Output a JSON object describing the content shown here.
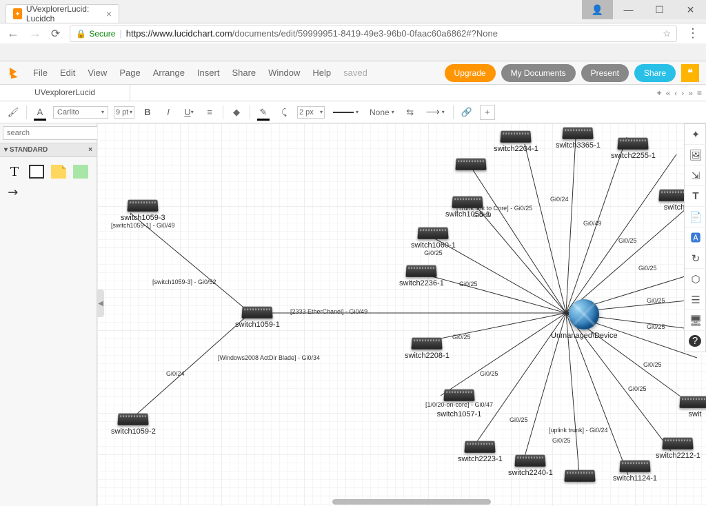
{
  "browser": {
    "tab_title": "UVexplorerLucid: Lucidch",
    "secure_label": "Secure",
    "url_host": "https://www.lucidchart.com",
    "url_path": "/documents/edit/59999951-8419-49e3-96b0-0faac60a6862#?None"
  },
  "menus": {
    "file": "File",
    "edit": "Edit",
    "view": "View",
    "page": "Page",
    "arrange": "Arrange",
    "insert": "Insert",
    "share": "Share",
    "window": "Window",
    "help": "Help",
    "saved": "saved"
  },
  "buttons": {
    "upgrade": "Upgrade",
    "my_documents": "My Documents",
    "present": "Present",
    "share": "Share"
  },
  "doc_tab": "UVexplorerLucid",
  "format": {
    "font": "Carlito",
    "size": "9 pt",
    "line_width": "2 px",
    "line_style": "None"
  },
  "left": {
    "search_placeholder": "search",
    "standard_header": "STANDARD"
  },
  "nodes": {
    "s1059_3": {
      "label": "switch1059-3",
      "sub": "[switch1059-1] - Gi0/49"
    },
    "s1059_1": {
      "label": "switch1059-1"
    },
    "s1059_2": {
      "label": "switch1059-2"
    },
    "center": {
      "label": "Unmanaged\\Device"
    },
    "s1060_1": {
      "label": "switch1060-1"
    },
    "s1058_1": {
      "label": "switch1058-1"
    },
    "s2204_1": {
      "label": "switch2204-1"
    },
    "s3365_1": {
      "label": "switch3365-1"
    },
    "s2255_1": {
      "label": "switch2255-1"
    },
    "s_right": {
      "label": "switch"
    },
    "s2236_1": {
      "label": "switch2236-1"
    },
    "s2208_1": {
      "label": "switch2208-1"
    },
    "s1057_1": {
      "label": "switch1057-1"
    },
    "s2223_1": {
      "label": "switch2223-1"
    },
    "s2240_1": {
      "label": "switch2240-1"
    },
    "s1124_1": {
      "label": "switch1124-1"
    },
    "s2212_1": {
      "label": "switch2212-1"
    },
    "s_br": {
      "label": "swit"
    }
  },
  "edges": {
    "e1": "[switch1059-3] - Gi0/52",
    "e2": "[2333 EtherChanel] - Gi0/49",
    "e3": "[Windows2008 ActDir Blade] - Gi0/34",
    "e4": "Gi0/24",
    "e5": "Gi0/25",
    "e6": "Gi0/25",
    "e7": "[Trunk link to Core] - Gi0/25",
    "e7b": "Gi0/49",
    "e8": "Gi0/24",
    "e9": "Gi0/49",
    "e10": "Gi0/25",
    "e11": "Gi0/25",
    "e12": "Gi0/25",
    "e13": "Gi0/25",
    "e14": "Gi0/25",
    "e15": "[1/0/20-on-core] - Gi0/47",
    "e16": "Gi0/25",
    "e17": "[uplink trunk] - Gi0/24",
    "e17b": "Gi0/25",
    "e18": "Gi0/25",
    "e19": "Gi0/25",
    "e20": "Gi0/25"
  }
}
